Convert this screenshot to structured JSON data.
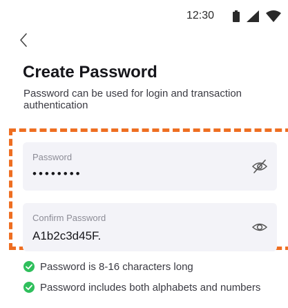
{
  "status_bar": {
    "time": "12:30",
    "icons": [
      "battery-icon",
      "signal-icon",
      "wifi-icon"
    ]
  },
  "header": {
    "back_icon": "chevron-left-icon"
  },
  "page": {
    "title": "Create Password",
    "subtitle": "Password can be used for login and transaction authentication"
  },
  "form": {
    "password": {
      "label": "Password",
      "value": "••••••••",
      "icon": "eye-off-icon"
    },
    "confirm_password": {
      "label": "Confirm Password",
      "value": "A1b2c3d45F.",
      "icon": "eye-icon"
    }
  },
  "rules": [
    {
      "text": "Password is 8-16 characters long",
      "status": "passed"
    },
    {
      "text": "Password includes both alphabets and numbers",
      "status": "passed"
    }
  ],
  "colors": {
    "highlight": "#ee6e21",
    "check": "#2fbf5c",
    "field_bg": "#f3f3f8"
  }
}
